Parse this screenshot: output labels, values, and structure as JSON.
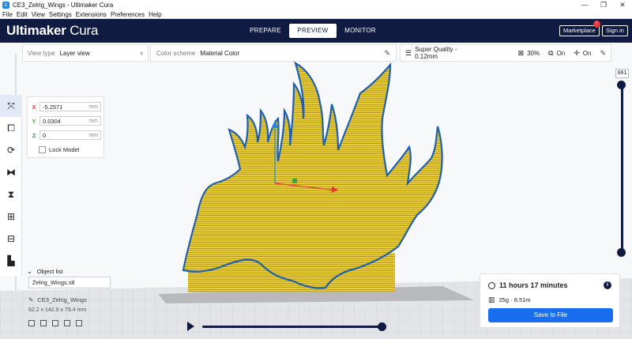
{
  "window": {
    "title": "CE3_Zelrig_Wings - Ultimaker Cura",
    "controls": [
      "—",
      "❐",
      "✕"
    ]
  },
  "menu": [
    "File",
    "Edit",
    "View",
    "Settings",
    "Extensions",
    "Preferences",
    "Help"
  ],
  "header": {
    "brand_bold": "Ultimaker",
    "brand_light": "Cura",
    "stages": [
      "PREPARE",
      "PREVIEW",
      "MONITOR"
    ],
    "active_stage": "PREVIEW",
    "marketplace_label": "Marketplace",
    "signin_label": "Sign in",
    "notification_count": "!"
  },
  "view_panel": {
    "label": "View type",
    "value": "Layer view"
  },
  "color_panel": {
    "label": "Color scheme",
    "value": "Material Color"
  },
  "print_settings": {
    "quality": "Super Quality - 0.12mm",
    "infill": "30%",
    "support": "On",
    "adhesion": "On"
  },
  "move_tool": {
    "x": "-5.2571",
    "y": "0.0304",
    "z": "0",
    "unit": "mm",
    "lock_label": "Lock Model",
    "axis_colors": {
      "x": "#e53935",
      "y": "#43a047",
      "z": "#1e88e5"
    }
  },
  "object_list": {
    "label": "Object list",
    "file": "Zelrig_Wings.stl",
    "name": "CE3_Zelrig_Wings",
    "dims": "62.2 x 142.9 x 79.4 mm"
  },
  "layer_slider": {
    "value": "661"
  },
  "print_info": {
    "time": "11 hours 17 minutes",
    "material": "25g · 8.51m",
    "save_label": "Save to File"
  },
  "colors": {
    "header": "#0f1b40",
    "accent": "#196ef0",
    "model": "#f1d33a",
    "model_outline": "#1f5fb0"
  }
}
